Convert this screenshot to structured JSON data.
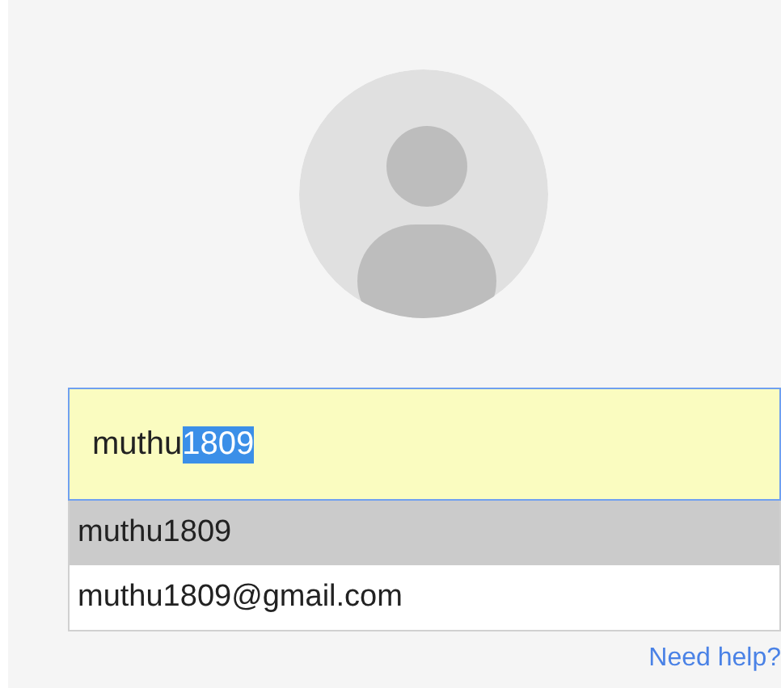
{
  "username_field": {
    "typed_text": "muthu",
    "highlighted_text": "1809"
  },
  "suggestions": [
    {
      "label": "muthu1809",
      "selected": true
    },
    {
      "label": "muthu1809@gmail.com",
      "selected": false
    }
  ],
  "help_link": "Need help?"
}
